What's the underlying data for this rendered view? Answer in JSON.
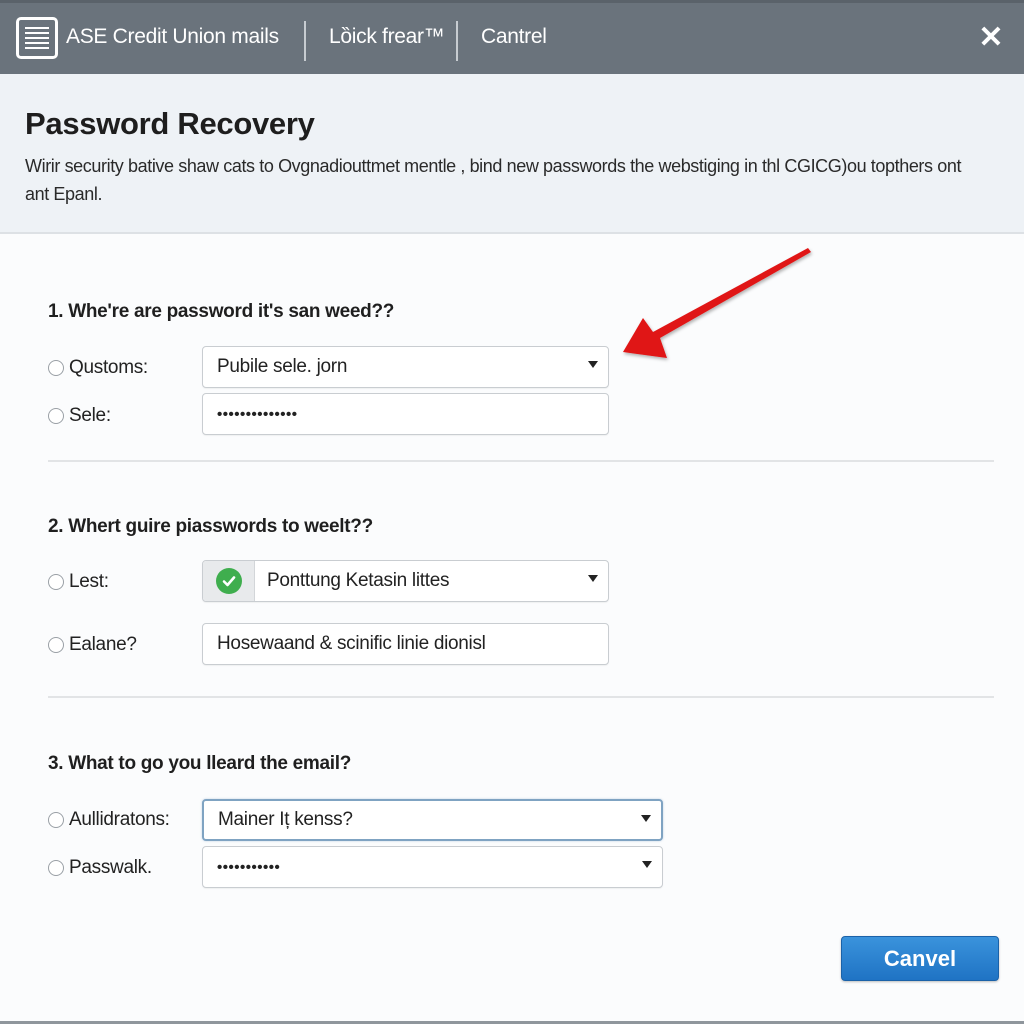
{
  "window": {
    "title_items": [
      "ASE Credit Union mails",
      "Lȍick frear™",
      "Cantrel"
    ],
    "close_icon": "close-icon",
    "app_icon": "document-list-icon"
  },
  "header": {
    "title": "Password Recovery",
    "description": "Wirir security bative shaw cats to Ovgnadiouttmet mentle , bind new passwords the webstiging in thl CGICG)ou topthers ont ant Epanl."
  },
  "sections": [
    {
      "question": "1. Whe're are password it's san weed??",
      "rows": [
        {
          "label": "Qustoms:",
          "type": "select",
          "value": "Pubile sele. jorn"
        },
        {
          "label": "Sele:",
          "type": "password",
          "value": "••••••••••••••"
        }
      ]
    },
    {
      "question": "2. Whert guire piasswords to weelt??",
      "rows": [
        {
          "label": "Lest:",
          "type": "select",
          "value": "Ponttung Ketasin littes",
          "addon_icon": "check-circle-icon"
        },
        {
          "label": "Ealane?",
          "type": "text",
          "value": "Hosewaand & scinific linie dionisl"
        }
      ]
    },
    {
      "question": "3. What to go you lleard the email?",
      "rows": [
        {
          "label": "Aullidratons:",
          "type": "select",
          "value": "Mainer Iț kenss?",
          "focused": true
        },
        {
          "label": "Passwalk.",
          "type": "password-select",
          "value": "•••••••••••"
        }
      ]
    }
  ],
  "footer": {
    "primary_button": "Canvel"
  },
  "annotation": {
    "arrow_color": "#e01414",
    "points_to": "Qustoms select"
  },
  "colors": {
    "titlebar": "#6a737c",
    "header_bg": "#eef2f6",
    "primary": "#2a83d2",
    "success": "#3fae4e"
  }
}
